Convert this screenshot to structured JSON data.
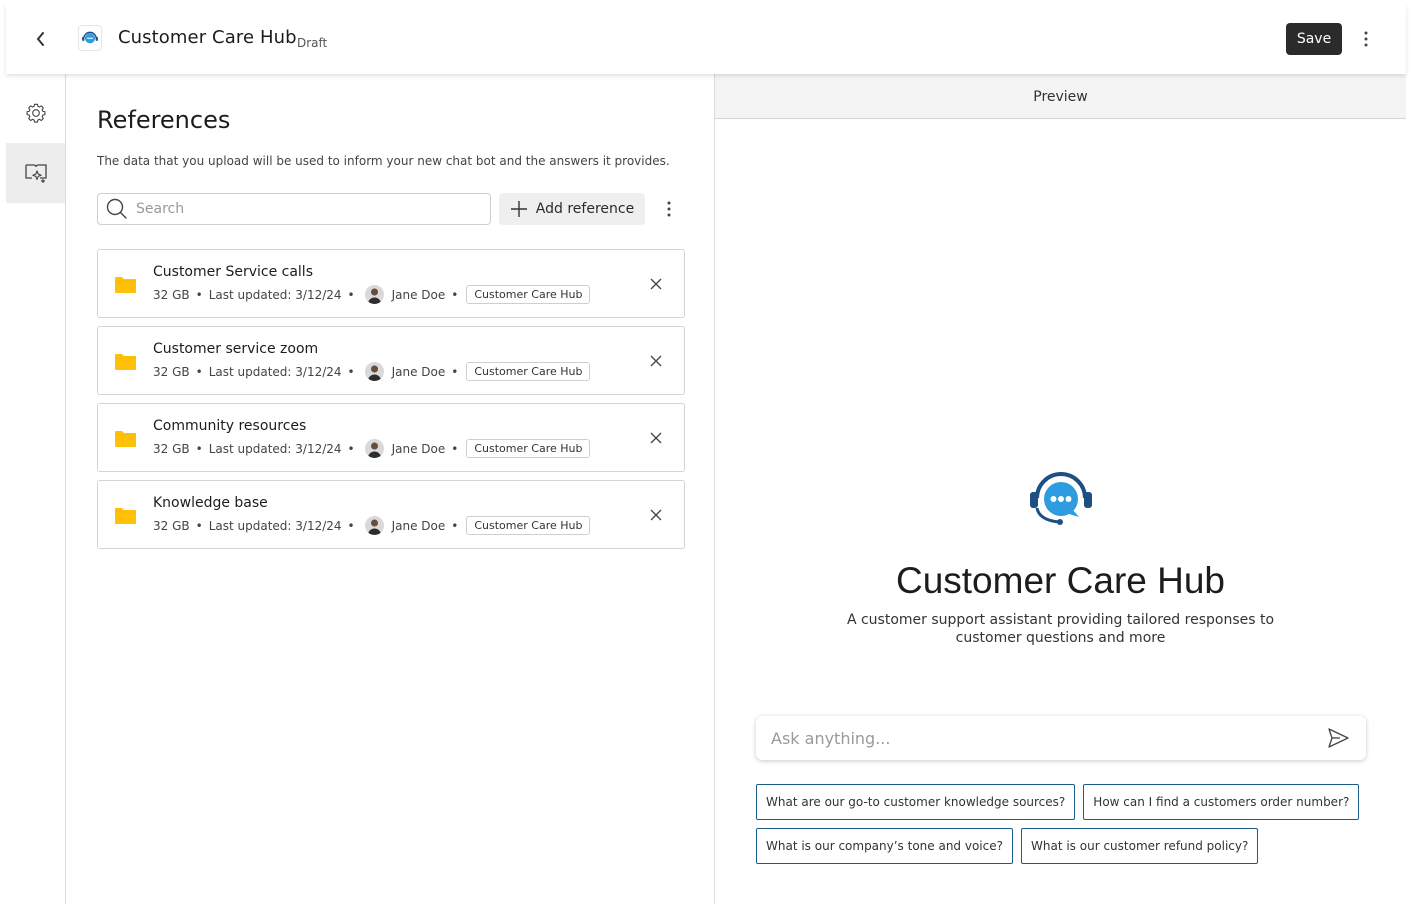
{
  "header": {
    "title": "Customer Care Hub",
    "status": "Draft",
    "save_label": "Save"
  },
  "sidebar": {
    "items": [
      {
        "name": "settings",
        "icon": "gear-icon",
        "active": false
      },
      {
        "name": "references",
        "icon": "knowledge-sparkle-icon",
        "active": true
      }
    ]
  },
  "references": {
    "title": "References",
    "description": "The data that you upload will be used to inform your new chat bot and the answers it provides.",
    "search": {
      "placeholder": "Search",
      "value": ""
    },
    "add_label": "Add reference",
    "items": [
      {
        "name": "Customer Service calls",
        "size": "32 GB",
        "updated": "Last updated: 3/12/24",
        "owner": "Jane Doe",
        "tag": "Customer Care Hub"
      },
      {
        "name": "Customer service zoom",
        "size": "32 GB",
        "updated": "Last updated: 3/12/24",
        "owner": "Jane Doe",
        "tag": "Customer Care Hub"
      },
      {
        "name": "Community resources",
        "size": "32 GB",
        "updated": "Last updated: 3/12/24",
        "owner": "Jane Doe",
        "tag": "Customer Care Hub"
      },
      {
        "name": "Knowledge base",
        "size": "32 GB",
        "updated": "Last updated: 3/12/24",
        "owner": "Jane Doe",
        "tag": "Customer Care Hub"
      }
    ]
  },
  "preview": {
    "header": "Preview",
    "bot_name": "Customer Care Hub",
    "bot_description": "A customer support assistant providing tailored responses to customer questions and more",
    "input": {
      "placeholder": "Ask anything...",
      "value": ""
    },
    "suggestions": [
      "What are our go-to customer knowledge sources?",
      "How can I find a customers order number?",
      "What is our company’s tone and voice?",
      "What is our customer refund policy?"
    ]
  },
  "colors": {
    "accent": "#1b5e8a",
    "icon_blue": "#2f9be0",
    "icon_dark_blue": "#1d4f85",
    "folder": "#ffc107",
    "save_bg": "#2b2b2b"
  }
}
